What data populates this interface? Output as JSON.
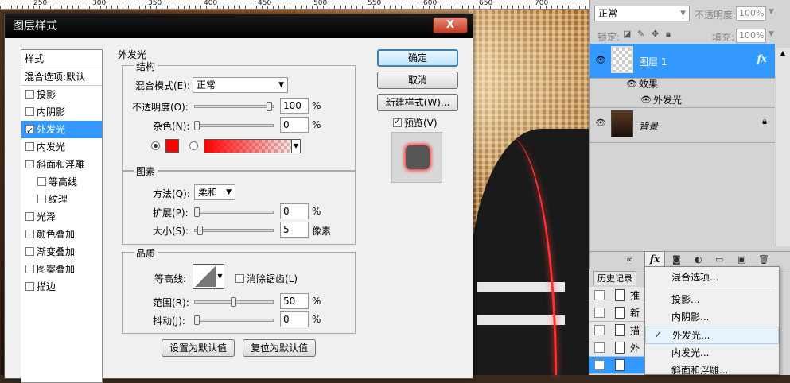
{
  "ruler": {
    "ticks": [
      "250",
      "300",
      "350",
      "400",
      "450",
      "500",
      "550",
      "600",
      "650",
      "700"
    ]
  },
  "dialog": {
    "title": "图层样式",
    "close_label": "X",
    "styles_header": "样式",
    "blend_options": "混合选项:默认",
    "styles": [
      {
        "label": "投影",
        "checked": false,
        "sub": false,
        "selected": false
      },
      {
        "label": "内阴影",
        "checked": false,
        "sub": false,
        "selected": false
      },
      {
        "label": "外发光",
        "checked": true,
        "sub": false,
        "selected": true
      },
      {
        "label": "内发光",
        "checked": false,
        "sub": false,
        "selected": false
      },
      {
        "label": "斜面和浮雕",
        "checked": false,
        "sub": false,
        "selected": false
      },
      {
        "label": "等高线",
        "checked": false,
        "sub": true,
        "selected": false
      },
      {
        "label": "纹理",
        "checked": false,
        "sub": true,
        "selected": false
      },
      {
        "label": "光泽",
        "checked": false,
        "sub": false,
        "selected": false
      },
      {
        "label": "颜色叠加",
        "checked": false,
        "sub": false,
        "selected": false
      },
      {
        "label": "渐变叠加",
        "checked": false,
        "sub": false,
        "selected": false
      },
      {
        "label": "图案叠加",
        "checked": false,
        "sub": false,
        "selected": false
      },
      {
        "label": "描边",
        "checked": false,
        "sub": false,
        "selected": false
      }
    ],
    "section_title": "外发光",
    "structure": {
      "title": "结构",
      "blend_mode_label": "混合模式(E):",
      "blend_mode_value": "正常",
      "opacity_label": "不透明度(O):",
      "opacity_value": "100",
      "opacity_unit": "%",
      "opacity_level": 1.0,
      "noise_label": "杂色(N):",
      "noise_value": "0",
      "noise_unit": "%",
      "noise_level": 0,
      "glow_color": "#ff0000"
    },
    "elements": {
      "title": "图素",
      "technique_label": "方法(Q):",
      "technique_value": "柔和",
      "spread_label": "扩展(P):",
      "spread_value": "0",
      "spread_unit": "%",
      "size_label": "大小(S):",
      "size_value": "5",
      "size_unit": "像素"
    },
    "quality": {
      "title": "品质",
      "contour_label": "等高线:",
      "antialias_label": "消除锯齿(L)",
      "range_label": "范围(R):",
      "range_value": "50",
      "range_unit": "%",
      "range_level": 0.5,
      "jitter_label": "抖动(J):",
      "jitter_value": "0",
      "jitter_unit": "%"
    },
    "buttons": {
      "ok": "确定",
      "cancel": "取消",
      "new_style": "新建样式(W)...",
      "preview": "预览(V)",
      "make_default": "设置为默认值",
      "reset_default": "复位为默认值"
    }
  },
  "layers": {
    "blend_mode": "正常",
    "opacity_label": "不透明度:",
    "opacity_value": "100%",
    "lock_label": "锁定:",
    "fill_label": "填充:",
    "fill_value": "100%",
    "layer1_name": "图层 1",
    "effects_label": "效果",
    "effect_outer_glow": "外发光",
    "background_name": "背景",
    "fx_label": "fx"
  },
  "history": {
    "tab": "历史记录",
    "rows": [
      "推",
      "新",
      "描",
      "外",
      ""
    ]
  },
  "fx_menu": {
    "items": [
      {
        "label": "混合选项...",
        "checked": false,
        "highlighted": false
      },
      {
        "label": "投影...",
        "checked": false,
        "highlighted": false
      },
      {
        "label": "内阴影...",
        "checked": false,
        "highlighted": false
      },
      {
        "label": "外发光...",
        "checked": true,
        "highlighted": true
      },
      {
        "label": "内发光...",
        "checked": false,
        "highlighted": false
      },
      {
        "label": "斜面和浮雕...",
        "checked": false,
        "highlighted": false
      }
    ]
  }
}
